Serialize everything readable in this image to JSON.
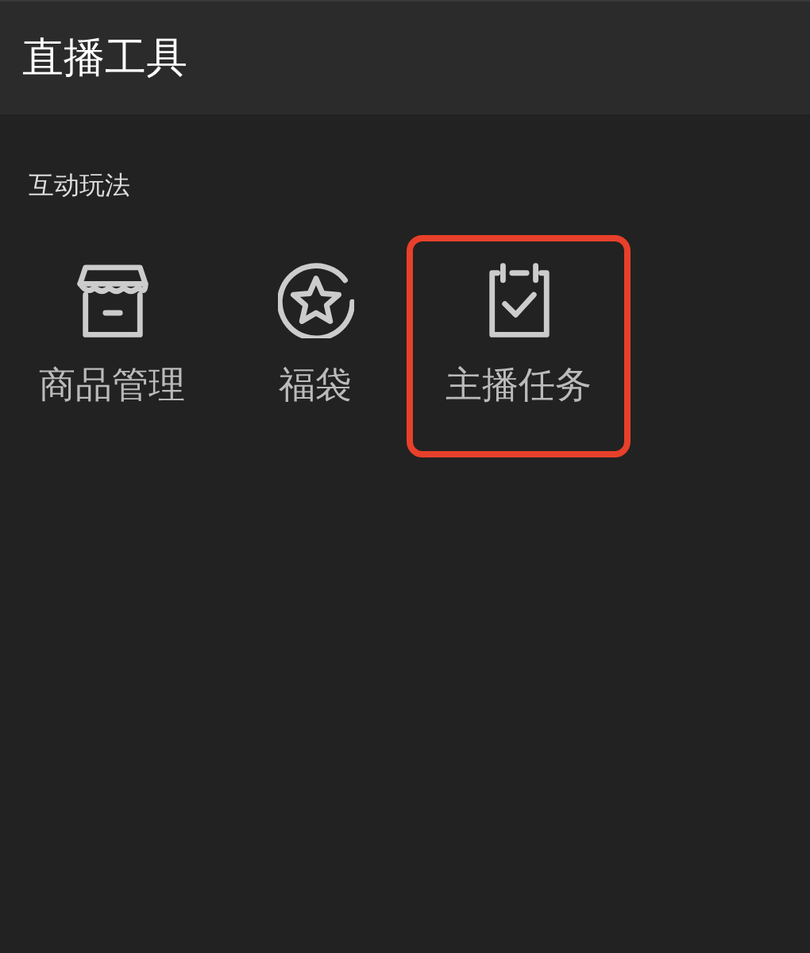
{
  "header": {
    "title": "直播工具"
  },
  "section": {
    "title": "互动玩法",
    "items": [
      {
        "label": "商品管理",
        "kind": "store",
        "selected": false
      },
      {
        "label": "福袋",
        "kind": "star",
        "selected": false
      },
      {
        "label": "主播任务",
        "kind": "task",
        "selected": true
      }
    ]
  }
}
